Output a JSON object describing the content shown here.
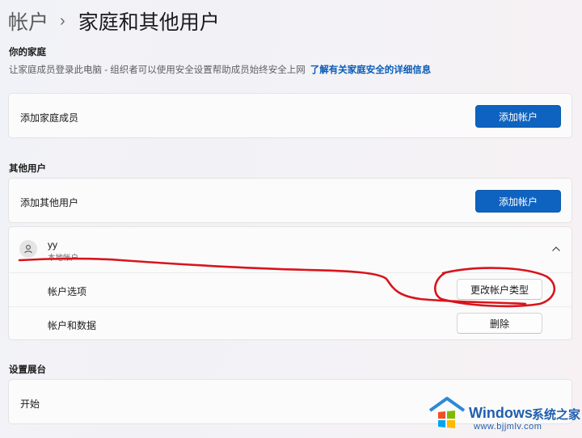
{
  "breadcrumb": {
    "parent": "帐户",
    "separator": "›",
    "current": "家庭和其他用户"
  },
  "family": {
    "title": "你的家庭",
    "description": "让家庭成员登录此电脑 - 组织者可以使用安全设置帮助成员始终安全上网",
    "link": "了解有关家庭安全的详细信息",
    "add_label": "添加家庭成员",
    "add_button": "添加帐户"
  },
  "others": {
    "title": "其他用户",
    "add_label": "添加其他用户",
    "add_button": "添加帐户",
    "user": {
      "name": "yy",
      "type": "本地帐户",
      "options_label": "帐户选项",
      "change_type_button": "更改帐户类型",
      "data_label": "帐户和数据",
      "delete_button": "删除"
    }
  },
  "kiosk": {
    "title": "设置展台",
    "start_label": "开始"
  },
  "watermark": {
    "brand": "Windows",
    "site_name": "系统之家",
    "url": "www.bjjmlv.com"
  },
  "colors": {
    "accent": "#0f63c0",
    "link": "#0a5cb8",
    "annotation": "#d8141c",
    "watermark_blue": "#1f5fae"
  },
  "icons": [
    "chevron-right-icon",
    "user-icon",
    "chevron-up-icon",
    "windows-logo-icon"
  ]
}
